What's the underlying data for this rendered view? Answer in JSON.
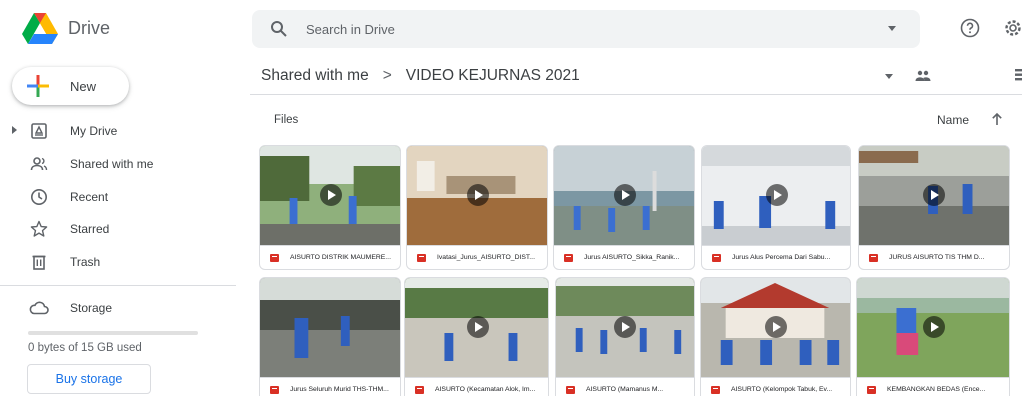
{
  "header": {
    "app_name": "Drive",
    "search_placeholder": "Search in Drive"
  },
  "sidebar": {
    "new_label": "New",
    "items": [
      {
        "label": "My Drive",
        "icon": "my-drive-icon"
      },
      {
        "label": "Shared with me",
        "icon": "people-icon"
      },
      {
        "label": "Recent",
        "icon": "clock-icon"
      },
      {
        "label": "Starred",
        "icon": "star-icon"
      },
      {
        "label": "Trash",
        "icon": "trash-icon"
      }
    ],
    "storage_label": "Storage",
    "storage_used_fraction": 0,
    "storage_text": "0 bytes of 15 GB used",
    "buy_storage": "Buy storage"
  },
  "main": {
    "breadcrumb": [
      "Shared with me",
      "VIDEO KEJURNAS 2021"
    ],
    "breadcrumb_separator": ">",
    "section_label": "Files",
    "sort_label": "Name",
    "files": [
      {
        "name": "AISURTO DISTRIK MAUMERE..."
      },
      {
        "name": "Ivatasi_Jurus_AISURTO_DIST..."
      },
      {
        "name": "Jurus AISURTO_Sikka_Ranik..."
      },
      {
        "name": "Jurus Alus Percema Dari Sabu..."
      },
      {
        "name": "JURUS AISURTO TIS THM D..."
      },
      {
        "name": "Jurus Seluruh Murid THS-THM..."
      },
      {
        "name": "AISURTO (Kecamatan Alok, Im..."
      },
      {
        "name": "AISURTO (Mamanus M..."
      },
      {
        "name": "AISURTO (Kelompok Tabuk, Ev..."
      },
      {
        "name": "KEMBANGKAN BEDAS (Ence..."
      }
    ]
  },
  "colors": {
    "accent": "#1a73e8",
    "file_icon": "#d93025",
    "search_bg": "#f1f3f4"
  }
}
